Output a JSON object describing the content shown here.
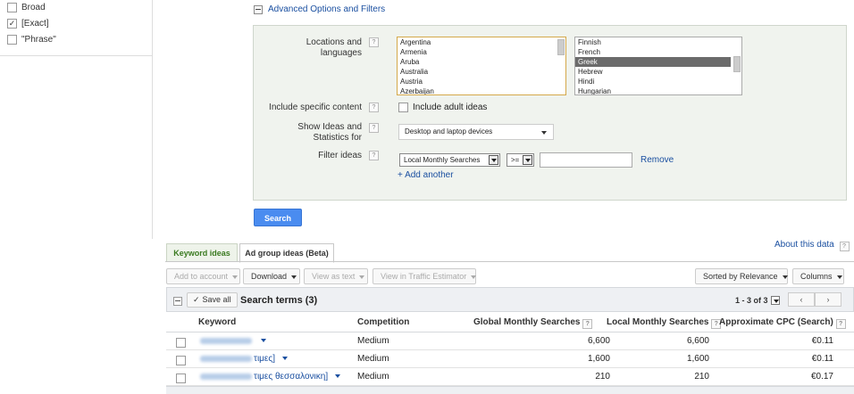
{
  "sidebar": {
    "match_types": [
      {
        "label": "Broad",
        "checked": false
      },
      {
        "label": "[Exact]",
        "checked": true
      },
      {
        "label": "\"Phrase\"",
        "checked": false
      }
    ]
  },
  "advanced": {
    "toggle_label": "Advanced Options and Filters",
    "locations_label": "Locations and languages",
    "locations": [
      "Argentina",
      "Armenia",
      "Aruba",
      "Australia",
      "Austria",
      "Azerbaijan"
    ],
    "languages": [
      "Finnish",
      "French",
      "Greek",
      "Hebrew",
      "Hindi",
      "Hungarian"
    ],
    "selected_language": "Greek",
    "specific_content_label": "Include specific content",
    "adult_ideas_label": "Include adult ideas",
    "show_ideas_label": "Show Ideas and Statistics for",
    "device_value": "Desktop and laptop devices",
    "filter_label": "Filter ideas",
    "filter_field": "Local Monthly Searches",
    "filter_operator": ">=",
    "filter_value": "",
    "remove_label": "Remove",
    "add_another_label": "+ Add another",
    "help_glyph": "?"
  },
  "search_button": "Search",
  "tabs": [
    {
      "label": "Keyword ideas",
      "active": false
    },
    {
      "label": "Ad group ideas (Beta)",
      "active": true
    }
  ],
  "about_link": "About this data",
  "toolbar": {
    "add_to_account": "Add to account",
    "download": "Download",
    "view_as_text": "View as text",
    "view_in_estimator": "View in Traffic Estimator",
    "sorted_by": "Sorted by Relevance",
    "columns": "Columns"
  },
  "results": {
    "save_all": "Save all",
    "title": "Search terms (3)",
    "pagination": "1 - 3 of 3",
    "prev": "‹",
    "next": "›",
    "columns": {
      "keyword": "Keyword",
      "competition": "Competition",
      "global": "Global Monthly Searches",
      "local": "Local Monthly Searches",
      "cpc": "Approximate CPC (Search)"
    },
    "rows": [
      {
        "keyword_suffix": "",
        "competition": "Medium",
        "global": "6,600",
        "local": "6,600",
        "cpc": "€0.11"
      },
      {
        "keyword_suffix": "τιμες]",
        "competition": "Medium",
        "global": "1,600",
        "local": "1,600",
        "cpc": "€0.11"
      },
      {
        "keyword_suffix": "τιμες θεσσαλονικη]",
        "competition": "Medium",
        "global": "210",
        "local": "210",
        "cpc": "€0.17"
      }
    ]
  },
  "colors": {
    "link": "#1a4fa0",
    "search_button": "#4a8cf0",
    "panel_bg": "#f0f3ee"
  }
}
